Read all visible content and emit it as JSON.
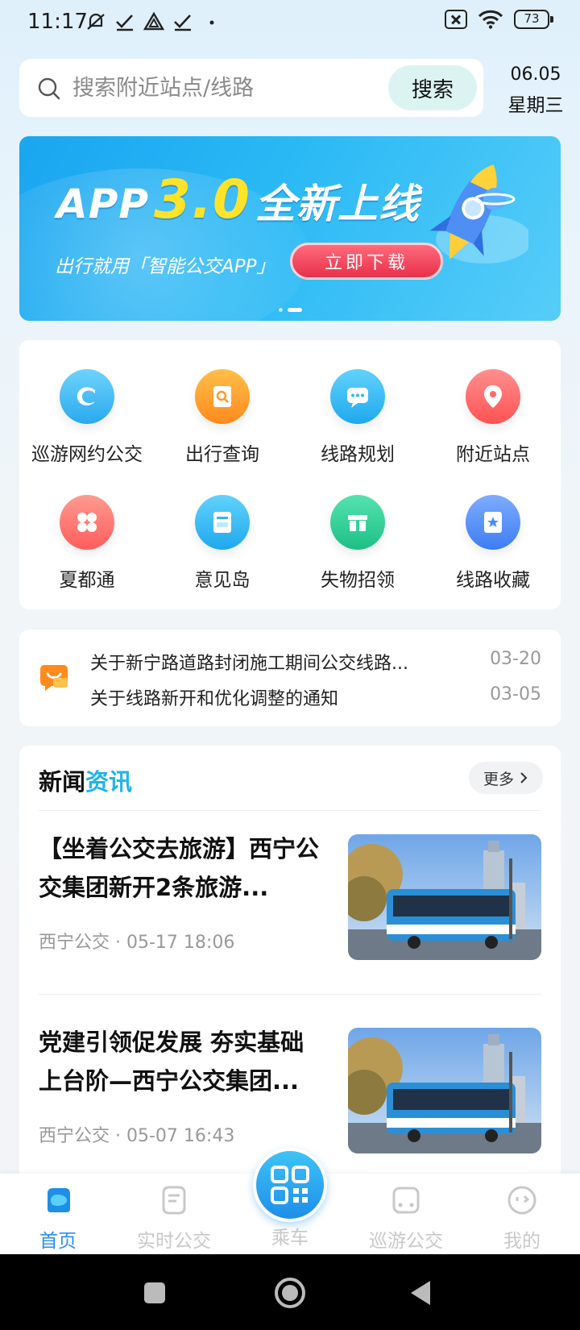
{
  "status_bar": {
    "time": "11:17",
    "battery": "73"
  },
  "search": {
    "placeholder": "搜索附近站点/线路",
    "button_label": "搜索"
  },
  "date": {
    "day": "06.05",
    "weekday": "星期三"
  },
  "banner": {
    "title_prefix": "APP",
    "title_version": "3.0",
    "title_suffix": "全新上线",
    "subtitle": "出行就用「智能公交APP」",
    "cta_label": "立即下载",
    "slide_count": 2,
    "active_slide": 2
  },
  "features": [
    {
      "label": "巡游网约公交",
      "icon": "swirl-icon",
      "color": "#35b6f0"
    },
    {
      "label": "出行查询",
      "icon": "doc-search-icon",
      "color": "#ff9a25"
    },
    {
      "label": "线路规划",
      "icon": "chat-bubble-icon",
      "color": "#2fb9f2"
    },
    {
      "label": "附近站点",
      "icon": "location-pin-icon",
      "color": "#ff6b6b"
    },
    {
      "label": "夏都通",
      "icon": "grid-flower-icon",
      "color": "#ff6f6f"
    },
    {
      "label": "意见岛",
      "icon": "mailbox-icon",
      "color": "#2fb9f2"
    },
    {
      "label": "失物招领",
      "icon": "box-icon",
      "color": "#2fd39a"
    },
    {
      "label": "线路收藏",
      "icon": "star-bookmark-icon",
      "color": "#4b8ef5"
    }
  ],
  "notices": [
    {
      "title": "关于新宁路道路封闭施工期间公交线路...",
      "date": "03-20"
    },
    {
      "title": "关于线路新开和优化调整的通知",
      "date": "03-05"
    }
  ],
  "news": {
    "title_plain": "新闻",
    "title_accent": "资讯",
    "more_label": "更多",
    "items": [
      {
        "title": "【坐着公交去旅游】西宁公交集团新开2条旅游...",
        "source": "西宁公交",
        "time": "05-17 18:06"
      },
      {
        "title": "党建引领促发展 夯实基础上台阶—西宁公交集团...",
        "source": "西宁公交",
        "time": "05-07 16:43"
      }
    ]
  },
  "bottom_nav": [
    {
      "label": "首页",
      "icon": "home-icon",
      "active": true
    },
    {
      "label": "实时公交",
      "icon": "realtime-bus-icon",
      "active": false
    },
    {
      "label": "乘车",
      "icon": "qr-code-icon",
      "active": false
    },
    {
      "label": "巡游公交",
      "icon": "bus-front-icon",
      "active": false
    },
    {
      "label": "我的",
      "icon": "profile-face-icon",
      "active": false
    }
  ],
  "colors": {
    "accent": "#1fb4e8",
    "nav_active": "#2a8ff0",
    "nav_inactive": "#c8c8c8"
  }
}
